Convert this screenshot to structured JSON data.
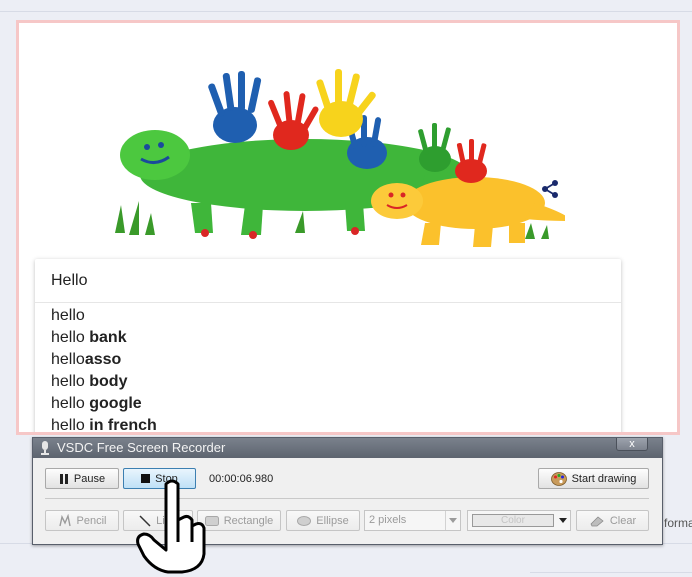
{
  "search": {
    "value": "Hello",
    "suggestions": [
      {
        "prefix": "hello",
        "bold": ""
      },
      {
        "prefix": "hello ",
        "bold": "bank"
      },
      {
        "prefix": "hello",
        "bold": "asso"
      },
      {
        "prefix": "hello ",
        "bold": "body"
      },
      {
        "prefix": "hello ",
        "bold": "google"
      },
      {
        "prefix": "hello ",
        "bold": "in french"
      }
    ]
  },
  "doodle": {
    "icon": "handprint-dinosaur-doodle",
    "share_icon": "share-icon"
  },
  "background": {
    "partial_text": "forma"
  },
  "recorder": {
    "title": "VSDC Free Screen Recorder",
    "close_label": "x",
    "pause_label": "Pause",
    "stop_label": "Stop",
    "timer": "00:00:06.980",
    "start_drawing_label": "Start drawing",
    "pencil_label": "Pencil",
    "line_label": "Line",
    "rectangle_label": "Rectangle",
    "ellipse_label": "Ellipse",
    "size_value": "2 pixels",
    "color_label": "Color",
    "clear_label": "Clear"
  },
  "colors": {
    "frame": "#f6c7c7",
    "title_bar": "#6a717c",
    "active_button": "#bfe0f6"
  }
}
